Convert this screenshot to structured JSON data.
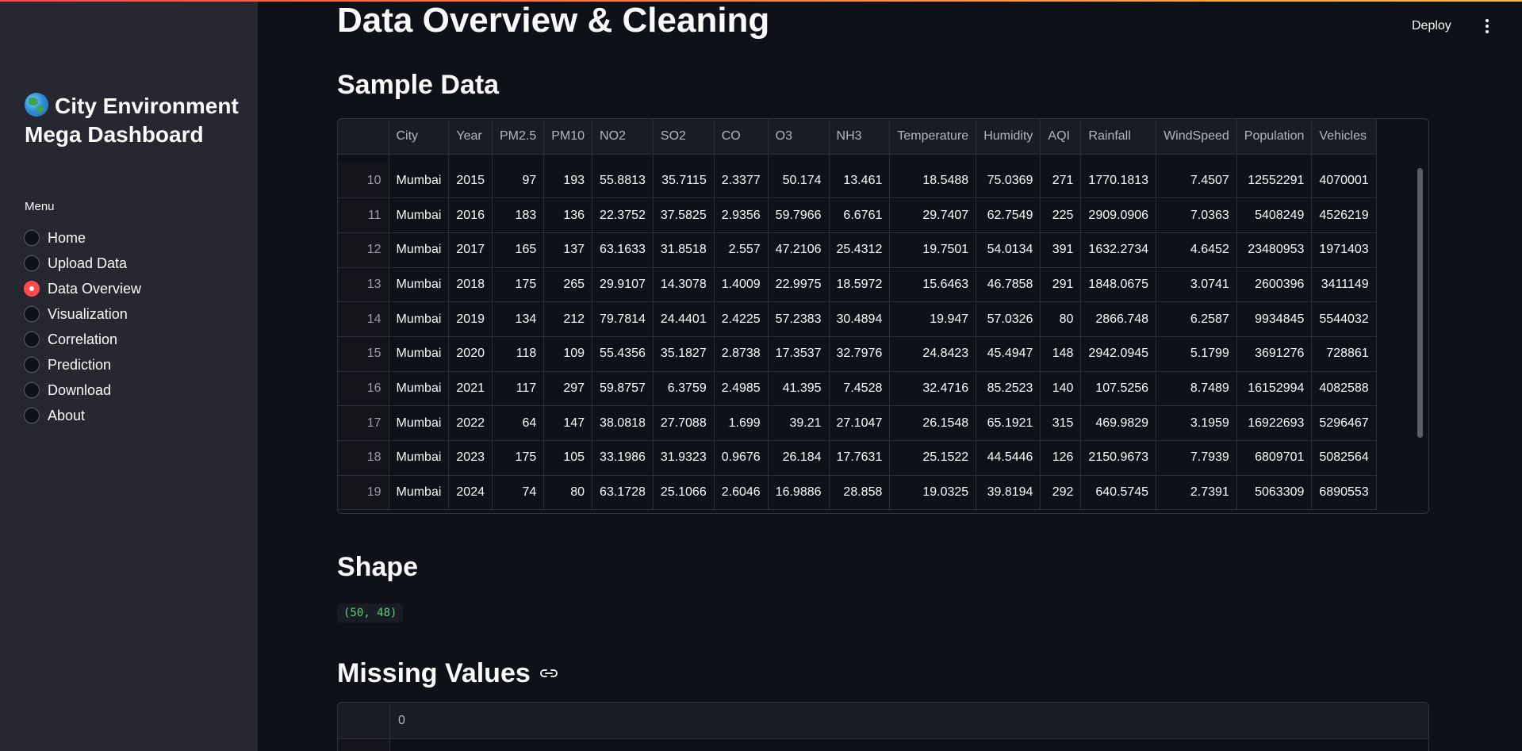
{
  "sidebar": {
    "title": "City Environment Mega Dashboard",
    "menu_label": "Menu",
    "items": [
      {
        "label": "Home",
        "selected": false
      },
      {
        "label": "Upload Data",
        "selected": false
      },
      {
        "label": "Data Overview",
        "selected": true
      },
      {
        "label": "Visualization",
        "selected": false
      },
      {
        "label": "Correlation",
        "selected": false
      },
      {
        "label": "Prediction",
        "selected": false
      },
      {
        "label": "Download",
        "selected": false
      },
      {
        "label": "About",
        "selected": false
      }
    ]
  },
  "header": {
    "deploy_label": "Deploy"
  },
  "main": {
    "title": "Data Overview & Cleaning",
    "sample_heading": "Sample Data",
    "shape_heading": "Shape",
    "shape_value": "(50, 48)",
    "missing_heading": "Missing Values",
    "missing_column_header": "0"
  },
  "sample_table": {
    "columns": [
      "",
      "City",
      "Year",
      "PM2.5",
      "PM10",
      "NO2",
      "SO2",
      "CO",
      "O3",
      "NH3",
      "Temperature",
      "Humidity",
      "AQI",
      "Rainfall",
      "WindSpeed",
      "Population",
      "Vehicles"
    ],
    "rows": [
      [
        "10",
        "Mumbai",
        "2015",
        "97",
        "193",
        "55.8813",
        "35.7115",
        "2.3377",
        "50.174",
        "13.461",
        "18.5488",
        "75.0369",
        "271",
        "1770.1813",
        "7.4507",
        "12552291",
        "4070001"
      ],
      [
        "11",
        "Mumbai",
        "2016",
        "183",
        "136",
        "22.3752",
        "37.5825",
        "2.9356",
        "59.7966",
        "6.6761",
        "29.7407",
        "62.7549",
        "225",
        "2909.0906",
        "7.0363",
        "5408249",
        "4526219"
      ],
      [
        "12",
        "Mumbai",
        "2017",
        "165",
        "137",
        "63.1633",
        "31.8518",
        "2.557",
        "47.2106",
        "25.4312",
        "19.7501",
        "54.0134",
        "391",
        "1632.2734",
        "4.6452",
        "23480953",
        "1971403"
      ],
      [
        "13",
        "Mumbai",
        "2018",
        "175",
        "265",
        "29.9107",
        "14.3078",
        "1.4009",
        "22.9975",
        "18.5972",
        "15.6463",
        "46.7858",
        "291",
        "1848.0675",
        "3.0741",
        "2600396",
        "3411149"
      ],
      [
        "14",
        "Mumbai",
        "2019",
        "134",
        "212",
        "79.7814",
        "24.4401",
        "2.4225",
        "57.2383",
        "30.4894",
        "19.947",
        "57.0326",
        "80",
        "2866.748",
        "6.2587",
        "9934845",
        "5544032"
      ],
      [
        "15",
        "Mumbai",
        "2020",
        "118",
        "109",
        "55.4356",
        "35.1827",
        "2.8738",
        "17.3537",
        "32.7976",
        "24.8423",
        "45.4947",
        "148",
        "2942.0945",
        "5.1799",
        "3691276",
        "728861"
      ],
      [
        "16",
        "Mumbai",
        "2021",
        "117",
        "297",
        "59.8757",
        "6.3759",
        "2.4985",
        "41.395",
        "7.4528",
        "32.4716",
        "85.2523",
        "140",
        "107.5256",
        "8.7489",
        "16152994",
        "4082588"
      ],
      [
        "17",
        "Mumbai",
        "2022",
        "64",
        "147",
        "38.0818",
        "27.7088",
        "1.699",
        "39.21",
        "27.1047",
        "26.1548",
        "65.1921",
        "315",
        "469.9829",
        "3.1959",
        "16922693",
        "5296467"
      ],
      [
        "18",
        "Mumbai",
        "2023",
        "175",
        "105",
        "33.1986",
        "31.9323",
        "0.9676",
        "26.184",
        "17.7631",
        "25.1522",
        "44.5446",
        "126",
        "2150.9673",
        "7.7939",
        "6809701",
        "5082564"
      ],
      [
        "19",
        "Mumbai",
        "2024",
        "74",
        "80",
        "63.1728",
        "25.1066",
        "2.6046",
        "16.9886",
        "28.858",
        "19.0325",
        "39.8194",
        "292",
        "640.5745",
        "2.7391",
        "5063309",
        "6890553"
      ]
    ]
  }
}
